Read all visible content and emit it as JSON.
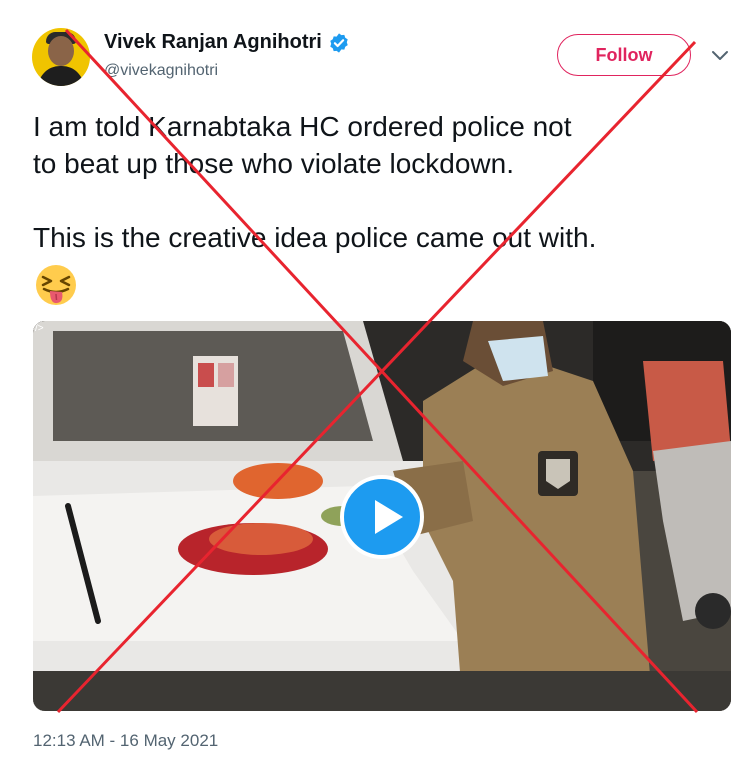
{
  "tweet": {
    "author": {
      "display_name": "Vivek Ranjan Agnihotri",
      "handle": "@vivekagnihotri",
      "verified": true,
      "avatar_icon": "profile-photo"
    },
    "follow_label": "Follow",
    "menu_icon": "chevron-down-icon",
    "text": "I am told Karnabtaka HC ordered police not\nto beat up those who violate lockdown.\n\nThis is the creative idea police came out with.",
    "emoji": "squinting-face-with-tongue",
    "media": {
      "type": "video",
      "gif_tag": "/>",
      "play_icon": "play-icon"
    },
    "timestamp": "12:13 AM - 16 May 2021"
  },
  "overlay": {
    "mark": "red-cross",
    "color": "#e8242f"
  },
  "colors": {
    "accent": "#1d9bf0",
    "follow": "#e0245e",
    "secondary_text": "#536471"
  }
}
